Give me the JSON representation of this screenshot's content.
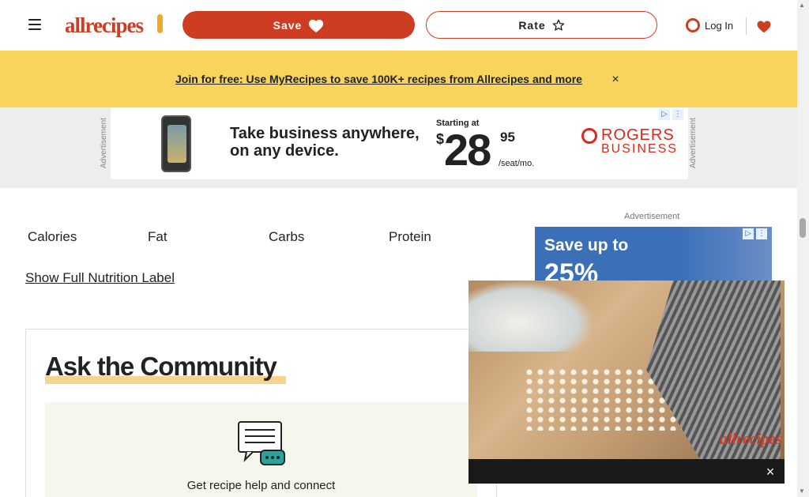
{
  "header": {
    "logo_text": "allrecipes",
    "save_label": "Save",
    "rate_label": "Rate",
    "login_label": "Log In"
  },
  "banner": {
    "link_text": "Join for free: Use MyRecipes to save 100K+ recipes from Allrecipes and more",
    "close_glyph": "×"
  },
  "top_ad": {
    "side_label": "Advertisement",
    "headline": "Take business anywhere, on any device.",
    "starting": "Starting at",
    "dollar": "$",
    "price": "28",
    "cents": "95",
    "unit": "/seat/mo.",
    "brand_line1": "ROGERS",
    "brand_line2": "BUSINESS"
  },
  "nutrition": {
    "items": [
      {
        "value": "",
        "label": "Calories"
      },
      {
        "value": "",
        "label": "Fat"
      },
      {
        "value": "",
        "label": "Carbs"
      },
      {
        "value": "",
        "label": "Protein"
      }
    ],
    "full_label_link": "Show Full Nutrition Label"
  },
  "right_ad": {
    "label": "Advertisement",
    "line1": "Save up to",
    "line2": "25%"
  },
  "community": {
    "title": "Ask the Community",
    "text": "Get recipe help and connect"
  },
  "video": {
    "logo": "allrecipes",
    "close_glyph": "×"
  },
  "colors": {
    "brand": "#ce3c22",
    "banner": "#f8d45c",
    "accent_underline": "#f5c060"
  }
}
